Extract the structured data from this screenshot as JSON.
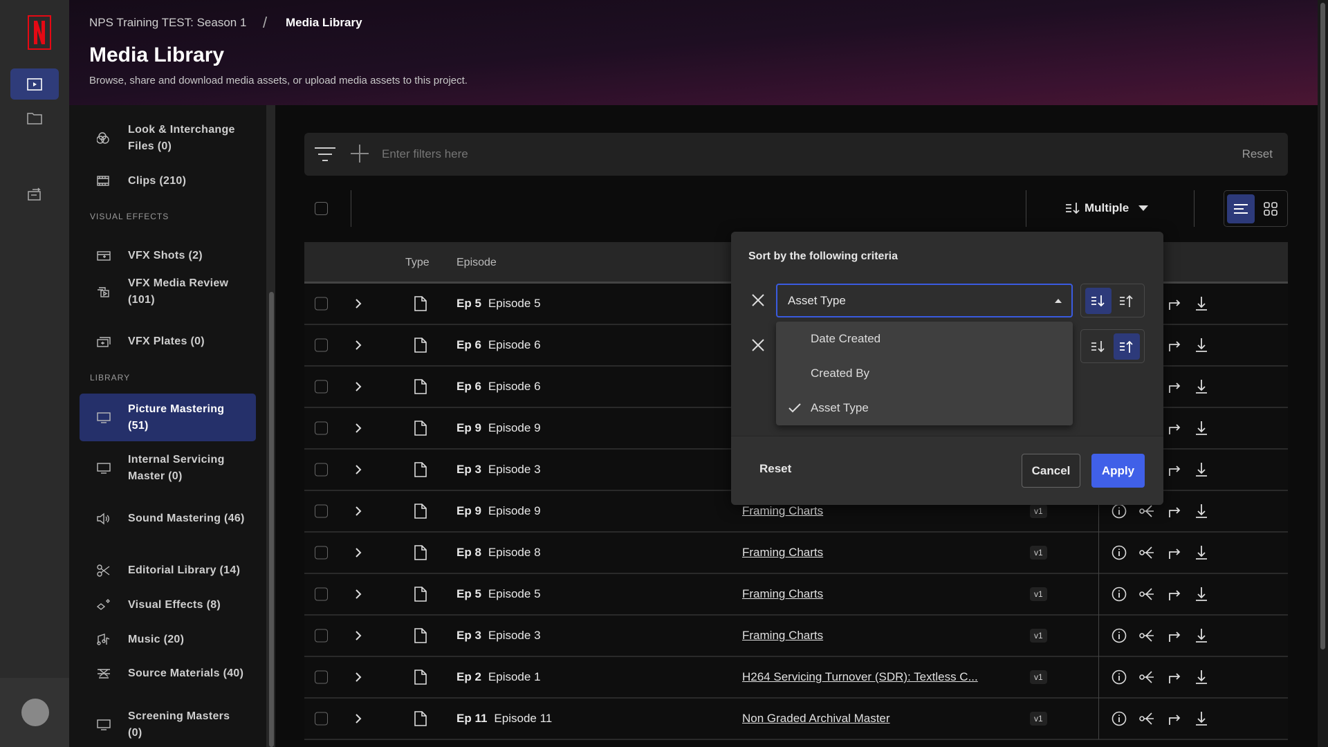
{
  "header": {
    "breadcrumb_project": "NPS Training TEST: Season 1",
    "breadcrumb_sep": "/",
    "breadcrumb_current": "Media Library",
    "title": "Media Library",
    "subtitle": "Browse, share and download media assets, or upload media assets to this project."
  },
  "sidebar": {
    "items_top": [
      {
        "label": "Look & Interchange Files (0)",
        "icon": "look-icon"
      },
      {
        "label": "Clips (210)",
        "icon": "film-icon"
      }
    ],
    "section_vfx": "VISUAL EFFECTS",
    "items_vfx": [
      {
        "label": "VFX Shots (2)",
        "icon": "clapper-icon"
      },
      {
        "label": "VFX Media Review (101)",
        "icon": "media-review-icon"
      },
      {
        "label": "VFX Plates (0)",
        "icon": "plates-icon"
      }
    ],
    "section_library": "LIBRARY",
    "items_library": [
      {
        "label": "Picture Mastering (51)",
        "icon": "monitor-icon",
        "active": true
      },
      {
        "label": "Internal Servicing Master (0)",
        "icon": "monitor-icon"
      },
      {
        "label": "Sound Mastering (46)",
        "icon": "speaker-icon"
      },
      {
        "label": "Editorial Library (14)",
        "icon": "scissors-icon"
      },
      {
        "label": "Visual Effects (8)",
        "icon": "sparkle-icon"
      },
      {
        "label": "Music (20)",
        "icon": "music-icon"
      },
      {
        "label": "Source Materials (40)",
        "icon": "source-icon"
      },
      {
        "label": "Screening Masters (0)",
        "icon": "monitor-icon"
      }
    ]
  },
  "filter": {
    "placeholder": "Enter filters here",
    "reset": "Reset"
  },
  "toolbar": {
    "sort_label": "Multiple"
  },
  "table": {
    "headers": {
      "type": "Type",
      "episode": "Episode"
    },
    "rows": [
      {
        "ep": "Ep 5",
        "episode": "Episode 5",
        "name": "",
        "version": ""
      },
      {
        "ep": "Ep 6",
        "episode": "Episode 6",
        "name": "",
        "version": ""
      },
      {
        "ep": "Ep 6",
        "episode": "Episode 6",
        "name": "",
        "version": ""
      },
      {
        "ep": "Ep 9",
        "episode": "Episode 9",
        "name": "",
        "version": ""
      },
      {
        "ep": "Ep 3",
        "episode": "Episode 3",
        "name": "",
        "version": ""
      },
      {
        "ep": "Ep 9",
        "episode": "Episode 9",
        "name": "Framing Charts",
        "version": "v1"
      },
      {
        "ep": "Ep 8",
        "episode": "Episode 8",
        "name": "Framing Charts",
        "version": "v1"
      },
      {
        "ep": "Ep 5",
        "episode": "Episode 5",
        "name": "Framing Charts",
        "version": "v1"
      },
      {
        "ep": "Ep 3",
        "episode": "Episode 3",
        "name": "Framing Charts",
        "version": "v1"
      },
      {
        "ep": "Ep 2",
        "episode": "Episode 1",
        "name": "H264 Servicing Turnover (SDR): Textless C...",
        "version": "v1"
      },
      {
        "ep": "Ep 11",
        "episode": "Episode 11",
        "name": "Non Graded Archival Master",
        "version": "v1"
      }
    ]
  },
  "sort_popup": {
    "title": "Sort by the following criteria",
    "criteria": [
      {
        "value": "Asset Type",
        "direction": "descending"
      },
      {
        "value": "",
        "direction": "ascending"
      }
    ],
    "options": [
      {
        "label": "Date Created",
        "selected": false
      },
      {
        "label": "Created By",
        "selected": false
      },
      {
        "label": "Asset Type",
        "selected": true
      }
    ],
    "reset": "Reset",
    "cancel": "Cancel",
    "apply": "Apply"
  },
  "colors": {
    "accent": "#4060e8",
    "active_nav": "#25306a",
    "brand": "#e50914"
  }
}
